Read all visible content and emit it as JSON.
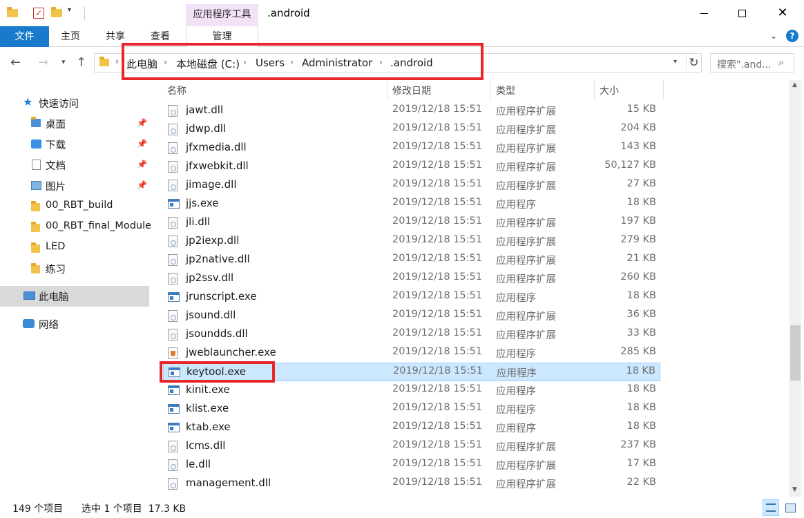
{
  "titlebar": {
    "context_tab": "应用程序工具",
    "title": ".android",
    "minimize_icon": "minimize-icon",
    "maximize_icon": "maximize-icon",
    "close_icon": "close-icon"
  },
  "ribbon": {
    "file_tab": "文件",
    "tabs": [
      "主页",
      "共享",
      "查看"
    ],
    "manage_tab": "管理"
  },
  "address": {
    "crumbs": [
      "此电脑",
      "本地磁盘 (C:)",
      "Users",
      "Administrator",
      ".android"
    ],
    "search_placeholder": "搜索\".and...",
    "highlight_color": "#e8262a"
  },
  "sidebar": {
    "quick_access": "快速访问",
    "pinned": [
      "桌面",
      "下载",
      "文档",
      "图片"
    ],
    "folders": [
      "00_RBT_build",
      "00_RBT_final_Module",
      "LED",
      "练习"
    ],
    "this_pc": "此电脑",
    "network": "网络"
  },
  "columns": {
    "name": "名称",
    "date": "修改日期",
    "type": "类型",
    "size": "大小"
  },
  "files": [
    {
      "name": "jawt.dll",
      "date": "2019/12/18 15:51",
      "type": "应用程序扩展",
      "size": "15 KB",
      "icon": "dll"
    },
    {
      "name": "jdwp.dll",
      "date": "2019/12/18 15:51",
      "type": "应用程序扩展",
      "size": "204 KB",
      "icon": "dll"
    },
    {
      "name": "jfxmedia.dll",
      "date": "2019/12/18 15:51",
      "type": "应用程序扩展",
      "size": "143 KB",
      "icon": "dll"
    },
    {
      "name": "jfxwebkit.dll",
      "date": "2019/12/18 15:51",
      "type": "应用程序扩展",
      "size": "50,127 KB",
      "icon": "dll"
    },
    {
      "name": "jimage.dll",
      "date": "2019/12/18 15:51",
      "type": "应用程序扩展",
      "size": "27 KB",
      "icon": "dll"
    },
    {
      "name": "jjs.exe",
      "date": "2019/12/18 15:51",
      "type": "应用程序",
      "size": "18 KB",
      "icon": "exe"
    },
    {
      "name": "jli.dll",
      "date": "2019/12/18 15:51",
      "type": "应用程序扩展",
      "size": "197 KB",
      "icon": "dll"
    },
    {
      "name": "jp2iexp.dll",
      "date": "2019/12/18 15:51",
      "type": "应用程序扩展",
      "size": "279 KB",
      "icon": "dll"
    },
    {
      "name": "jp2native.dll",
      "date": "2019/12/18 15:51",
      "type": "应用程序扩展",
      "size": "21 KB",
      "icon": "dll"
    },
    {
      "name": "jp2ssv.dll",
      "date": "2019/12/18 15:51",
      "type": "应用程序扩展",
      "size": "260 KB",
      "icon": "dll"
    },
    {
      "name": "jrunscript.exe",
      "date": "2019/12/18 15:51",
      "type": "应用程序",
      "size": "18 KB",
      "icon": "exe"
    },
    {
      "name": "jsound.dll",
      "date": "2019/12/18 15:51",
      "type": "应用程序扩展",
      "size": "36 KB",
      "icon": "dll"
    },
    {
      "name": "jsoundds.dll",
      "date": "2019/12/18 15:51",
      "type": "应用程序扩展",
      "size": "33 KB",
      "icon": "dll"
    },
    {
      "name": "jweblauncher.exe",
      "date": "2019/12/18 15:51",
      "type": "应用程序",
      "size": "285 KB",
      "icon": "java"
    },
    {
      "name": "keytool.exe",
      "date": "2019/12/18 15:51",
      "type": "应用程序",
      "size": "18 KB",
      "icon": "exe",
      "selected": true
    },
    {
      "name": "kinit.exe",
      "date": "2019/12/18 15:51",
      "type": "应用程序",
      "size": "18 KB",
      "icon": "exe"
    },
    {
      "name": "klist.exe",
      "date": "2019/12/18 15:51",
      "type": "应用程序",
      "size": "18 KB",
      "icon": "exe"
    },
    {
      "name": "ktab.exe",
      "date": "2019/12/18 15:51",
      "type": "应用程序",
      "size": "18 KB",
      "icon": "exe"
    },
    {
      "name": "lcms.dll",
      "date": "2019/12/18 15:51",
      "type": "应用程序扩展",
      "size": "237 KB",
      "icon": "dll"
    },
    {
      "name": "le.dll",
      "date": "2019/12/18 15:51",
      "type": "应用程序扩展",
      "size": "17 KB",
      "icon": "dll"
    },
    {
      "name": "management.dll",
      "date": "2019/12/18 15:51",
      "type": "应用程序扩展",
      "size": "22 KB",
      "icon": "dll"
    }
  ],
  "status": {
    "count": "149 个项目",
    "selection": "选中 1 个项目  17.3 KB"
  },
  "colors": {
    "accent": "#1979ca",
    "selected_row": "#cce8ff",
    "context_tab": "#f3e1f8"
  }
}
